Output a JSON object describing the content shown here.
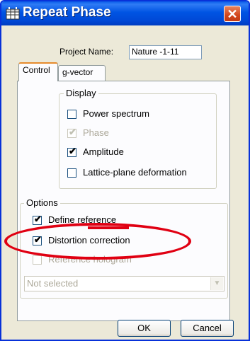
{
  "window": {
    "title": "Repeat Phase",
    "close_glyph": "✕"
  },
  "project": {
    "label": "Project Name:",
    "value": "Nature -1-11"
  },
  "tabs": [
    {
      "label": "Control",
      "active": true
    },
    {
      "label": "g-vector",
      "active": false
    }
  ],
  "display": {
    "title": "Display",
    "items": [
      {
        "label": "Power spectrum",
        "checked": false,
        "enabled": true
      },
      {
        "label": "Phase",
        "checked": true,
        "enabled": false
      },
      {
        "label": "Amplitude",
        "checked": true,
        "enabled": true
      },
      {
        "label": "Lattice-plane deformation",
        "checked": false,
        "enabled": true
      }
    ]
  },
  "options": {
    "title": "Options",
    "items": [
      {
        "label": "Define reference",
        "checked": true,
        "enabled": true
      },
      {
        "label": "Distortion correction",
        "checked": true,
        "enabled": true
      },
      {
        "label": "Reference hologram",
        "checked": false,
        "enabled": false
      }
    ],
    "select": {
      "value": "Not selected",
      "enabled": false
    }
  },
  "buttons": {
    "ok": "OK",
    "cancel": "Cancel"
  },
  "icons": {
    "app": "grid-app-icon",
    "check": "checkmark-icon",
    "dropdown": "chevron-down-icon"
  },
  "colors": {
    "title_bar": "#0054e3",
    "annotation": "#e00012",
    "close_button": "#d2461c"
  }
}
